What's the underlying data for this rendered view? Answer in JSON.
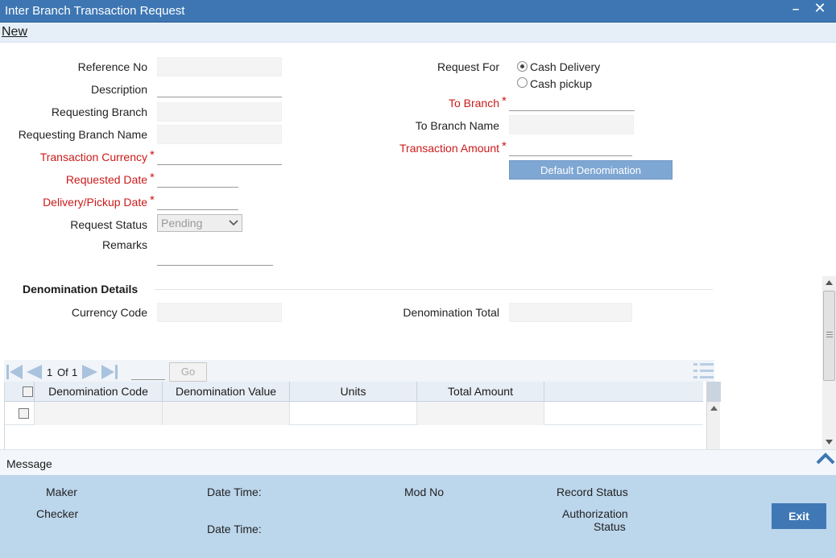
{
  "window": {
    "title": "Inter Branch Transaction Request",
    "minimize": "–",
    "close": "✕"
  },
  "toolbar": {
    "new_label": "New"
  },
  "form": {
    "reference_no": "Reference No",
    "description": "Description",
    "requesting_branch": "Requesting Branch",
    "requesting_branch_name": "Requesting Branch Name",
    "transaction_currency": "Transaction Currency",
    "requested_date": "Requested Date",
    "delivery_pickup_date": "Delivery/Pickup Date",
    "request_status": "Request Status",
    "request_status_value": "Pending",
    "remarks": "Remarks",
    "request_for": "Request For",
    "cash_delivery": "Cash Delivery",
    "cash_pickup": "Cash pickup",
    "to_branch": "To Branch",
    "to_branch_name": "To Branch Name",
    "transaction_amount": "Transaction Amount",
    "default_denomination": "Default Denomination",
    "required_mark": "*"
  },
  "denomination": {
    "section_title": "Denomination Details",
    "currency_code": "Currency Code",
    "denomination_total": "Denomination Total"
  },
  "pager": {
    "page": "1",
    "of_label": "Of",
    "total": "1",
    "go": "Go"
  },
  "grid": {
    "columns": [
      "Denomination Code",
      "Denomination Value",
      "Units",
      "Total Amount"
    ]
  },
  "message": {
    "label": "Message"
  },
  "footer": {
    "maker": "Maker",
    "checker": "Checker",
    "date_time": "Date Time:",
    "date_time_2": "Date Time:",
    "mod_no": "Mod No",
    "record_status": "Record Status",
    "authorization": "Authorization",
    "status": "Status",
    "exit": "Exit"
  },
  "colors": {
    "titlebar": "#3d76b3",
    "required": "#cc1a1a",
    "footer": "#bcd6ec",
    "exit_button": "#3f78b5"
  }
}
